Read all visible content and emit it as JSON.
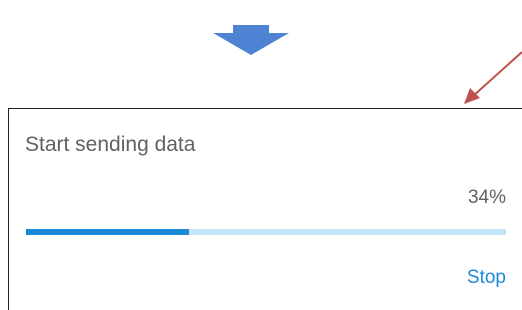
{
  "dialog": {
    "title": "Start sending data",
    "percent_text": "34%",
    "progress": 0.34,
    "stop_label": "Stop"
  },
  "colors": {
    "accent": "#1a8ad6",
    "track": "#c5e3f6",
    "text": "#616161",
    "down_arrow": "#4e83d4",
    "annotation_arrow": "#c0504d"
  },
  "icons": {
    "down_arrow": "down-arrow-icon",
    "annotation_arrow": "pointer-arrow-icon"
  }
}
